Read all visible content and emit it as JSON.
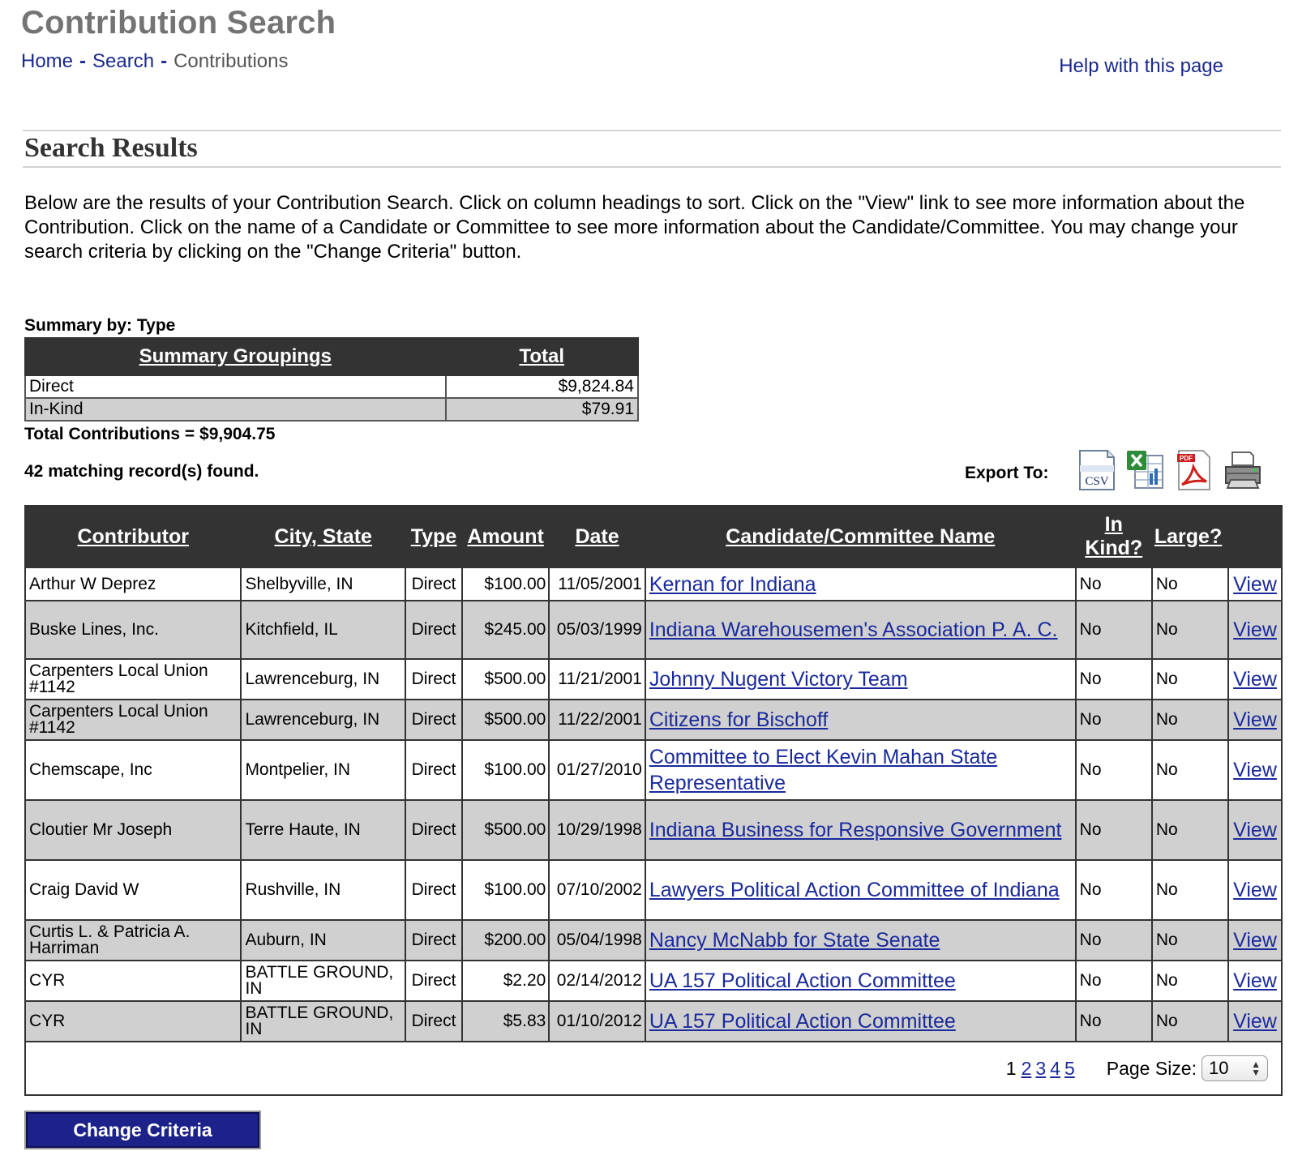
{
  "header": {
    "title": "Contribution Search",
    "breadcrumb": [
      "Home",
      "Search",
      "Contributions"
    ],
    "breadcrumb_separator": "-",
    "help_link": "Help with this page"
  },
  "section_title": "Search Results",
  "intro": "Below are the results of your Contribution Search. Click on column headings to sort. Click on the \"View\" link to see more information about the Contribution. Click on the name of a Candidate or Committee to see more information about the Candidate/Committee. You may change your search criteria by clicking on the \"Change Criteria\" button.",
  "summary": {
    "label": "Summary by: Type",
    "headers": [
      "Summary Groupings",
      "Total"
    ],
    "rows": [
      {
        "group": "Direct",
        "total": "$9,824.84"
      },
      {
        "group": "In-Kind",
        "total": "$79.91"
      }
    ],
    "total_line": "Total Contributions = $9,904.75"
  },
  "match_count": "42 matching record(s) found.",
  "export": {
    "label": "Export To:",
    "icons": [
      "csv-icon",
      "excel-icon",
      "pdf-icon",
      "printer-icon"
    ],
    "csv_text": "CSV",
    "pdf_text": "PDF"
  },
  "results": {
    "headers": {
      "contributor": "Contributor",
      "city_state": "City, State",
      "type": "Type",
      "amount": "Amount",
      "date": "Date",
      "candidate": "Candidate/Committee Name",
      "in_kind_1": "In",
      "in_kind_2": "Kind?",
      "large": "Large?"
    },
    "rows": [
      {
        "contributor": "Arthur W Deprez",
        "city": "Shelbyville, IN",
        "type": "Direct",
        "amount": "$100.00",
        "date": "11/05/2001",
        "candidate": "Kernan for Indiana",
        "in_kind": "No",
        "large": "No",
        "view": "View"
      },
      {
        "contributor": "Buske Lines, Inc.",
        "city": "Kitchfield, IL",
        "type": "Direct",
        "amount": "$245.00",
        "date": "05/03/1999",
        "candidate": "Indiana Warehousemen's Association P. A. C.",
        "in_kind": "No",
        "large": "No",
        "view": "View"
      },
      {
        "contributor": "Carpenters Local Union #1142",
        "city": "Lawrenceburg, IN",
        "type": "Direct",
        "amount": "$500.00",
        "date": "11/21/2001",
        "candidate": "Johnny Nugent Victory Team",
        "in_kind": "No",
        "large": "No",
        "view": "View"
      },
      {
        "contributor": "Carpenters Local Union #1142",
        "city": "Lawrenceburg, IN",
        "type": "Direct",
        "amount": "$500.00",
        "date": "11/22/2001",
        "candidate": "Citizens for Bischoff",
        "in_kind": "No",
        "large": "No",
        "view": "View"
      },
      {
        "contributor": "Chemscape, Inc",
        "city": "Montpelier, IN",
        "type": "Direct",
        "amount": "$100.00",
        "date": "01/27/2010",
        "candidate": "Committee to Elect Kevin Mahan State Representative",
        "in_kind": "No",
        "large": "No",
        "view": "View"
      },
      {
        "contributor": "Cloutier Mr Joseph",
        "city": "Terre Haute, IN",
        "type": "Direct",
        "amount": "$500.00",
        "date": "10/29/1998",
        "candidate": "Indiana Business for Responsive Government",
        "in_kind": "No",
        "large": "No",
        "view": "View"
      },
      {
        "contributor": "Craig David W",
        "city": "Rushville, IN",
        "type": "Direct",
        "amount": "$100.00",
        "date": "07/10/2002",
        "candidate": "Lawyers Political Action Committee of Indiana",
        "in_kind": "No",
        "large": "No",
        "view": "View"
      },
      {
        "contributor": "Curtis L. & Patricia A. Harriman",
        "city": "Auburn, IN",
        "type": "Direct",
        "amount": "$200.00",
        "date": "05/04/1998",
        "candidate": "Nancy McNabb for State Senate",
        "in_kind": "No",
        "large": "No",
        "view": "View"
      },
      {
        "contributor": "CYR",
        "city": "BATTLE GROUND, IN",
        "type": "Direct",
        "amount": "$2.20",
        "date": "02/14/2012",
        "candidate": "UA 157 Political Action Committee",
        "in_kind": "No",
        "large": "No",
        "view": "View"
      },
      {
        "contributor": "CYR",
        "city": "BATTLE GROUND, IN",
        "type": "Direct",
        "amount": "$5.83",
        "date": "01/10/2012",
        "candidate": "UA 157 Political Action Committee",
        "in_kind": "No",
        "large": "No",
        "view": "View"
      }
    ]
  },
  "pager": {
    "current": "1",
    "pages": [
      "2",
      "3",
      "4",
      "5"
    ],
    "page_size_label": "Page Size:",
    "page_size": "10"
  },
  "change_criteria": "Change Criteria",
  "colors": {
    "link": "#1a2a9c",
    "header_bg": "#333333",
    "alt_row": "#d0d0d0",
    "button_bg": "#1c2289",
    "title_gray": "#747474"
  }
}
